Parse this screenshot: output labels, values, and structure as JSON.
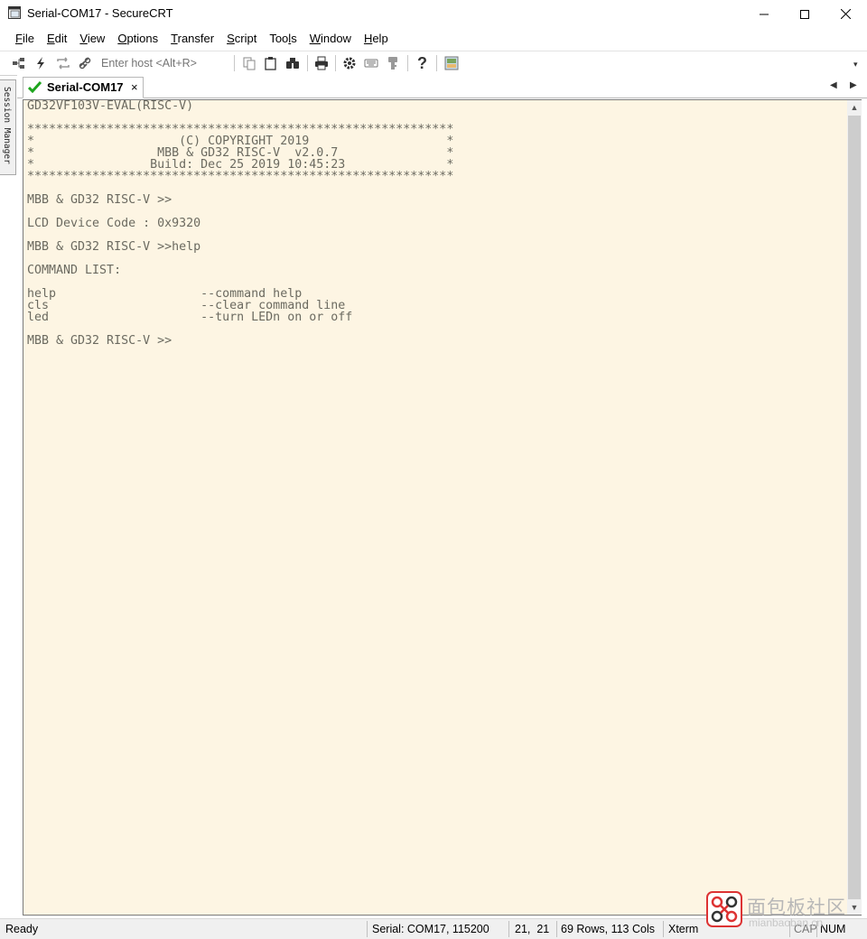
{
  "window": {
    "title": "Serial-COM17 - SecureCRT",
    "controls": {
      "minimize": "—",
      "maximize": "☐",
      "close": "✕"
    }
  },
  "menu": [
    {
      "label": "File",
      "hotkey": "F",
      "rest": "ile"
    },
    {
      "label": "Edit",
      "hotkey": "E",
      "rest": "dit"
    },
    {
      "label": "View",
      "hotkey": "V",
      "rest": "iew"
    },
    {
      "label": "Options",
      "hotkey": "O",
      "rest": "ptions"
    },
    {
      "label": "Transfer",
      "hotkey": "T",
      "rest": "ransfer"
    },
    {
      "label": "Script",
      "hotkey": "S",
      "rest": "cript"
    },
    {
      "label": "Tools",
      "pre": "Too",
      "hotkey": "l",
      "rest": "s"
    },
    {
      "label": "Window",
      "hotkey": "W",
      "rest": "indow"
    },
    {
      "label": "Help",
      "hotkey": "H",
      "rest": "elp"
    }
  ],
  "toolbar": {
    "host_placeholder": "Enter host <Alt+R>",
    "icons": [
      "connect-bar-icon",
      "quick-connect-icon",
      "reconnect-icon",
      "disconnect-icon",
      "copy-icon",
      "paste-icon",
      "find-icon",
      "print-icon",
      "session-options-icon",
      "keymap-icon",
      "sftp-key-icon",
      "help-icon",
      "screen-icon"
    ],
    "overflow": "▾"
  },
  "side_panel": {
    "label": "Session Manager"
  },
  "tabs": [
    {
      "label": "Serial-COM17",
      "status": "connected",
      "close": "×"
    }
  ],
  "tab_nav": {
    "prev": "◀",
    "next": "▶"
  },
  "terminal": {
    "lines": [
      "GD32VF103V-EVAL(RISC-V)",
      "",
      "***********************************************************",
      "*                    (C) COPYRIGHT 2019                   *",
      "*                 MBB & GD32 RISC-V  v2.0.7               *",
      "*                Build: Dec 25 2019 10:45:23              *",
      "***********************************************************",
      "",
      "MBB & GD32 RISC-V >>",
      "",
      "LCD Device Code : 0x9320",
      "",
      "MBB & GD32 RISC-V >>help",
      "",
      "COMMAND LIST:",
      "",
      "help                    --command help",
      "cls                     --clear command line",
      "led                     --turn LEDn on or off",
      "",
      "MBB & GD32 RISC-V >>"
    ],
    "background": "#fdf5e3",
    "foreground": "#6b6a60"
  },
  "status": {
    "ready": "Ready",
    "serial": "Serial: COM17, 115200",
    "cursor": "21,  21",
    "size": "69 Rows, 113 Cols",
    "emulation": "Xterm",
    "cap": "CAP",
    "num": "NUM"
  },
  "watermark": {
    "text": "面包板社区",
    "sub": "mianbaoban.cn"
  }
}
